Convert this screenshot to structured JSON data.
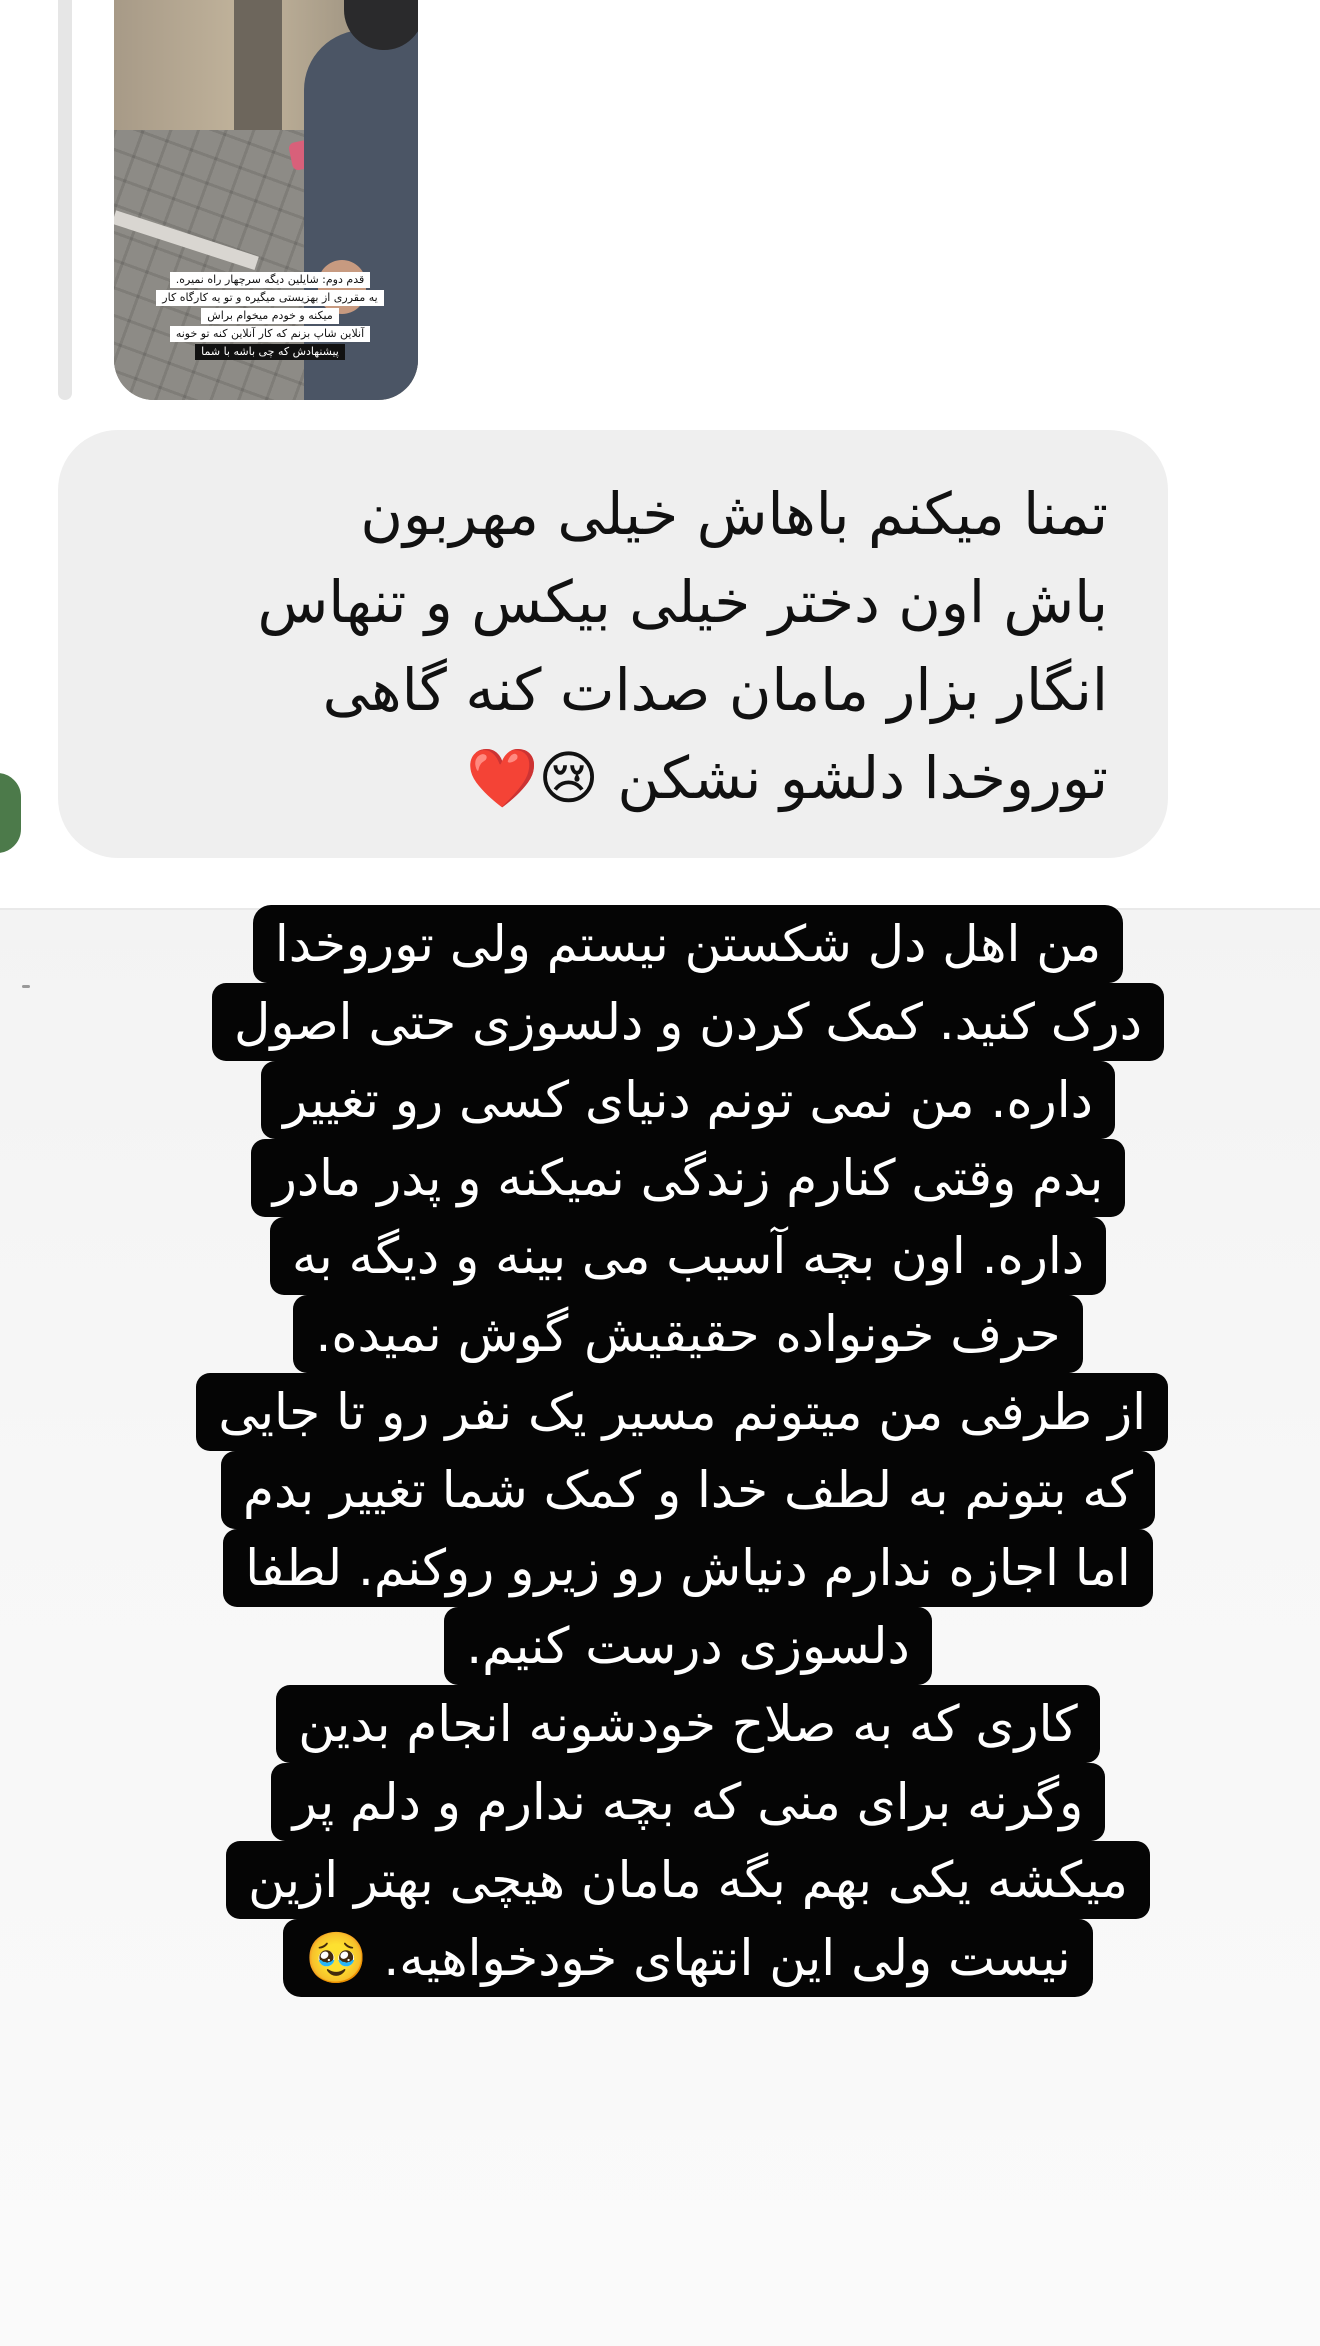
{
  "reply_thumbnail": {
    "caption_lines": [
      "قدم دوم: شایلین دیگه سرچهار راه نمیره.",
      "یه مقرری از بهزیستی میگیره و تو یه کارگاه کار",
      "میکنه و خودم میخوام براش",
      "آنلاین شاپ بزنم که کار آنلاین کنه تو خونه",
      "پیشنهادش که چی باشه با شما"
    ]
  },
  "received_message": {
    "lines": [
      "تمنا میکنم باهاش خیلی مهربون",
      "باش اون دختر خیلی بیکس و تنهاس",
      "انگار بزار مامان صدات کنه گاهی",
      "توروخدا دلشو نشکن 😢❤️"
    ]
  },
  "story_text": {
    "lines": [
      "من اهل دل شکستن نیستم ولی توروخدا",
      "درک کنید. کمک کردن و دلسوزی حتی اصول",
      "داره. من نمی تونم دنیای کسی رو تغییر",
      "بدم وقتی کنارم زندگی نمیکنه و پدر مادر",
      "داره. اون بچه  آسیب می بینه و دیگه به",
      "حرف خونواده حقیقیش گوش نمیده.",
      "از طرفی من میتونم مسیر یک نفر رو تا جایی",
      "که بتونم به لطف خدا و کمک شما تغییر بدم",
      "اما اجازه ندارم دنیاش رو زیرو روکنم. لطفا",
      "دلسوزی درست کنیم.",
      "کاری که به صلاح خودشونه انجام بدین",
      "وگرنه برای منی که بچه ندارم و دلم پر",
      "میکشه یکی بهم بگه مامان هیچی بهتر ازین",
      "نیست ولی این انتهای خودخواهیه. 🥹"
    ]
  },
  "colors": {
    "received_bubble": "#efefef",
    "story_highlight": "#050505",
    "story_text": "#ffffff",
    "message_text": "#111111"
  }
}
